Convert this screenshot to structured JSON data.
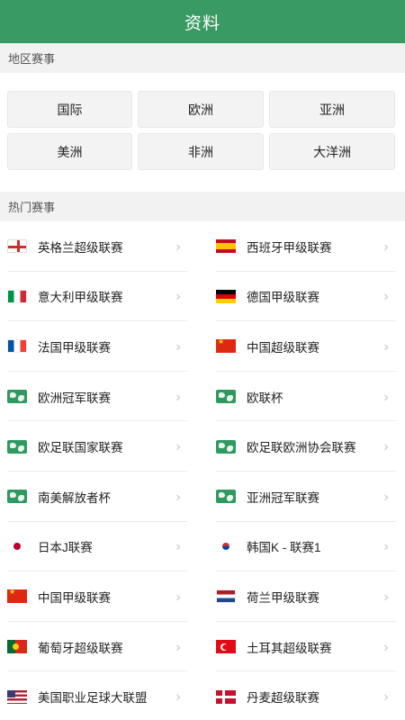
{
  "header": {
    "title": "资料"
  },
  "region_section": {
    "title": "地区赛事",
    "buttons": [
      "国际",
      "欧洲",
      "亚洲",
      "美洲",
      "非洲",
      "大洋洲"
    ]
  },
  "hot_section": {
    "title": "热门赛事",
    "leagues": [
      {
        "name": "英格兰超级联赛",
        "icon": "england-flag-icon"
      },
      {
        "name": "西班牙甲级联赛",
        "icon": "spain-flag-icon"
      },
      {
        "name": "意大利甲级联赛",
        "icon": "italy-flag-icon"
      },
      {
        "name": "德国甲级联赛",
        "icon": "germany-flag-icon"
      },
      {
        "name": "法国甲级联赛",
        "icon": "france-flag-icon"
      },
      {
        "name": "中国超级联赛",
        "icon": "china-flag-icon"
      },
      {
        "name": "欧洲冠军联赛",
        "icon": "world-map-icon"
      },
      {
        "name": "欧联杯",
        "icon": "world-map-icon"
      },
      {
        "name": "欧足联国家联赛",
        "icon": "world-map-icon"
      },
      {
        "name": "欧足联欧洲协会联赛",
        "icon": "world-map-icon"
      },
      {
        "name": "南美解放者杯",
        "icon": "world-map-icon"
      },
      {
        "name": "亚洲冠军联赛",
        "icon": "world-map-icon"
      },
      {
        "name": "日本J联赛",
        "icon": "japan-flag-icon"
      },
      {
        "name": "韩国K - 联赛1",
        "icon": "korea-flag-icon"
      },
      {
        "name": "中国甲级联赛",
        "icon": "china-flag-icon"
      },
      {
        "name": "荷兰甲级联赛",
        "icon": "netherlands-flag-icon"
      },
      {
        "name": "葡萄牙超级联赛",
        "icon": "portugal-flag-icon"
      },
      {
        "name": "土耳其超级联赛",
        "icon": "turkey-flag-icon"
      },
      {
        "name": "美国职业足球大联盟",
        "icon": "usa-flag-icon"
      },
      {
        "name": "丹麦超级联赛",
        "icon": "denmark-flag-icon"
      }
    ]
  },
  "colors": {
    "header": "#3a9a63",
    "section_bg": "#f2f2f2",
    "button_bg": "#f3f3f3"
  }
}
